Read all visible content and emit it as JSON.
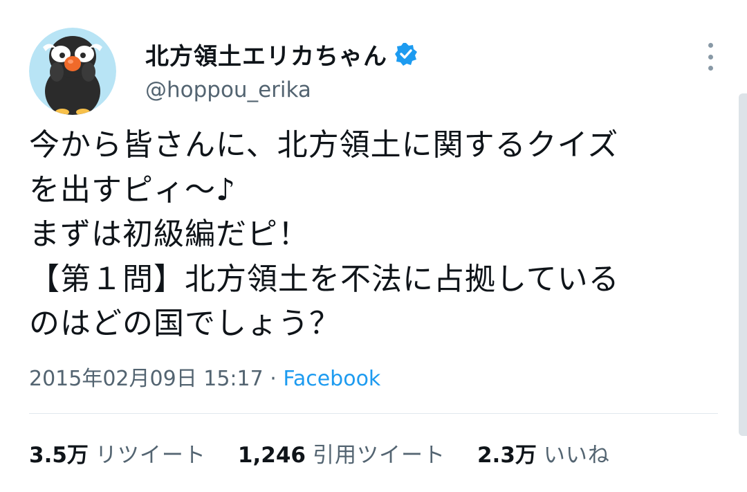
{
  "tweet": {
    "author": {
      "display_name": "北方領土エリカちゃん",
      "handle": "@hoppou_erika",
      "verified": true,
      "avatar_icon": "penguin-mascot-icon"
    },
    "text_lines": [
      "今から皆さんに、北方領土に関するクイズ",
      "を出すピィ～♪",
      "まずは初級編だピ！",
      "【第１問】北方領土を不法に占拠している",
      "のはどの国でしょう？"
    ],
    "timestamp": "2015年02月09日 15:17",
    "separator": "·",
    "source": "Facebook",
    "stats": [
      {
        "count": "3.5万",
        "label": "リツイート"
      },
      {
        "count": "1,246",
        "label": "引用ツイート"
      },
      {
        "count": "2.3万",
        "label": "いいね"
      }
    ]
  },
  "colors": {
    "text": "#0f1419",
    "secondary": "#536471",
    "accent": "#1d9bf0",
    "divider": "#e1e8ed",
    "avatar_bg": "#b8e4f5"
  },
  "icons": {
    "verified": "verified-badge-icon",
    "more": "more-options-icon"
  }
}
